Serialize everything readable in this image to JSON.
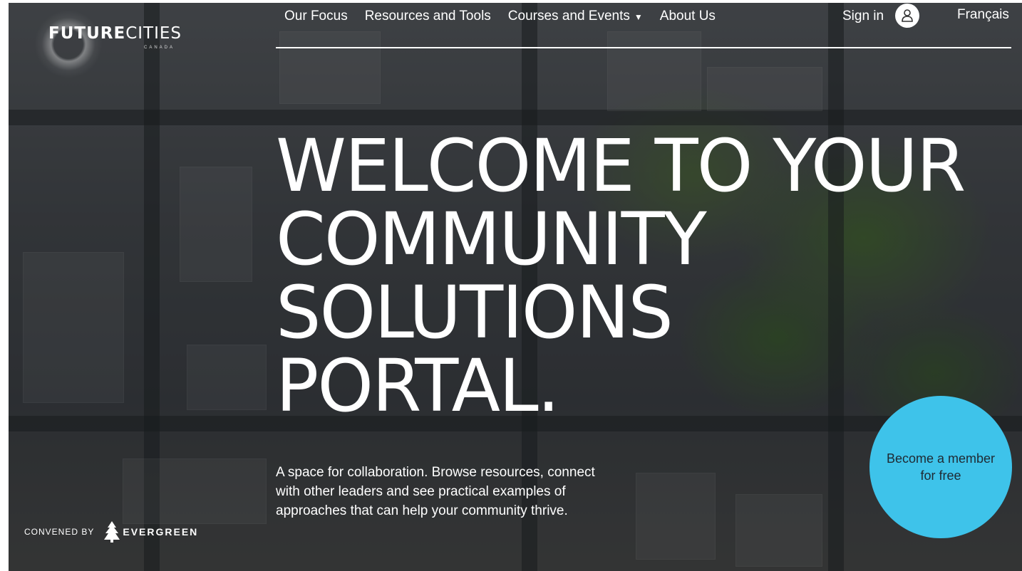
{
  "header": {
    "logo": {
      "brand_bold": "FUTURE",
      "brand_light": "CITIES",
      "brand_sub": "CANADA"
    },
    "nav": [
      {
        "label": "Our Focus"
      },
      {
        "label": "Resources and Tools"
      },
      {
        "label": "Courses and Events",
        "has_dropdown": true
      },
      {
        "label": "About Us"
      }
    ],
    "sign_in_label": "Sign in",
    "user_icon": "user-icon",
    "language_label": "Français"
  },
  "hero": {
    "title_lines": [
      "WELCOME TO YOUR",
      "COMMUNITY",
      "SOLUTIONS",
      "PORTAL."
    ],
    "description": "A space for collaboration. Browse resources, connect with other leaders and see practical examples of approaches that can help your community thrive."
  },
  "cta": {
    "label": "Become a member for free",
    "color": "#3ec3ea"
  },
  "footer": {
    "convened_label": "CONVENED BY",
    "partner_name": "EVERGREEN",
    "partner_icon": "tree-icon"
  }
}
